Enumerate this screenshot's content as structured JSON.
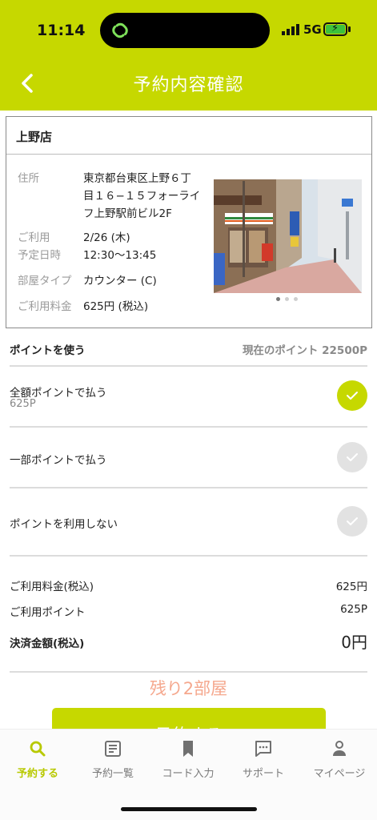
{
  "status": {
    "time": "11:14",
    "network": "5G"
  },
  "header": {
    "title": "予約内容確認"
  },
  "store": {
    "name": "上野店",
    "address_label": "住所",
    "address_lines": [
      "東京都台東区上野６丁",
      "目１６−１５フォーライ",
      "フ上野駅前ビル2F"
    ],
    "date_label_lines": [
      "ご利用",
      "予定日時"
    ],
    "date": "2/26 (木)",
    "time": "12:30〜13:45",
    "room_label": "部屋タイプ",
    "room": "カウンター (C)",
    "fee_label": "ご利用料金",
    "fee": "625円 (税込)"
  },
  "points": {
    "heading": "ポイントを使う",
    "current": "現在のポイント 22500P",
    "options": [
      {
        "label": "全額ポイントで払う",
        "sub": "625P",
        "selected": true
      },
      {
        "label": "一部ポイントで払う",
        "selected": false
      },
      {
        "label": "ポイントを利用しない",
        "selected": false
      }
    ]
  },
  "summary": {
    "fee_label": "ご利用料金(税込)",
    "fee_value": "625円",
    "points_label": "ご利用ポイント",
    "points_value": "625P",
    "total_label": "決済金額(税込)",
    "total_value": "0円"
  },
  "remaining": "残り2部屋",
  "reserve_button": "予約する",
  "tabs": [
    {
      "label": "予約する",
      "icon": "search-icon",
      "active": true
    },
    {
      "label": "予約一覧",
      "icon": "list-icon",
      "active": false
    },
    {
      "label": "コード入力",
      "icon": "bookmark-icon",
      "active": false
    },
    {
      "label": "サポート",
      "icon": "chat-icon",
      "active": false
    },
    {
      "label": "マイページ",
      "icon": "person-icon",
      "active": false
    }
  ],
  "colors": {
    "accent": "#c6d800",
    "remaining": "#f5a88e",
    "tab_active": "#b8c900"
  }
}
